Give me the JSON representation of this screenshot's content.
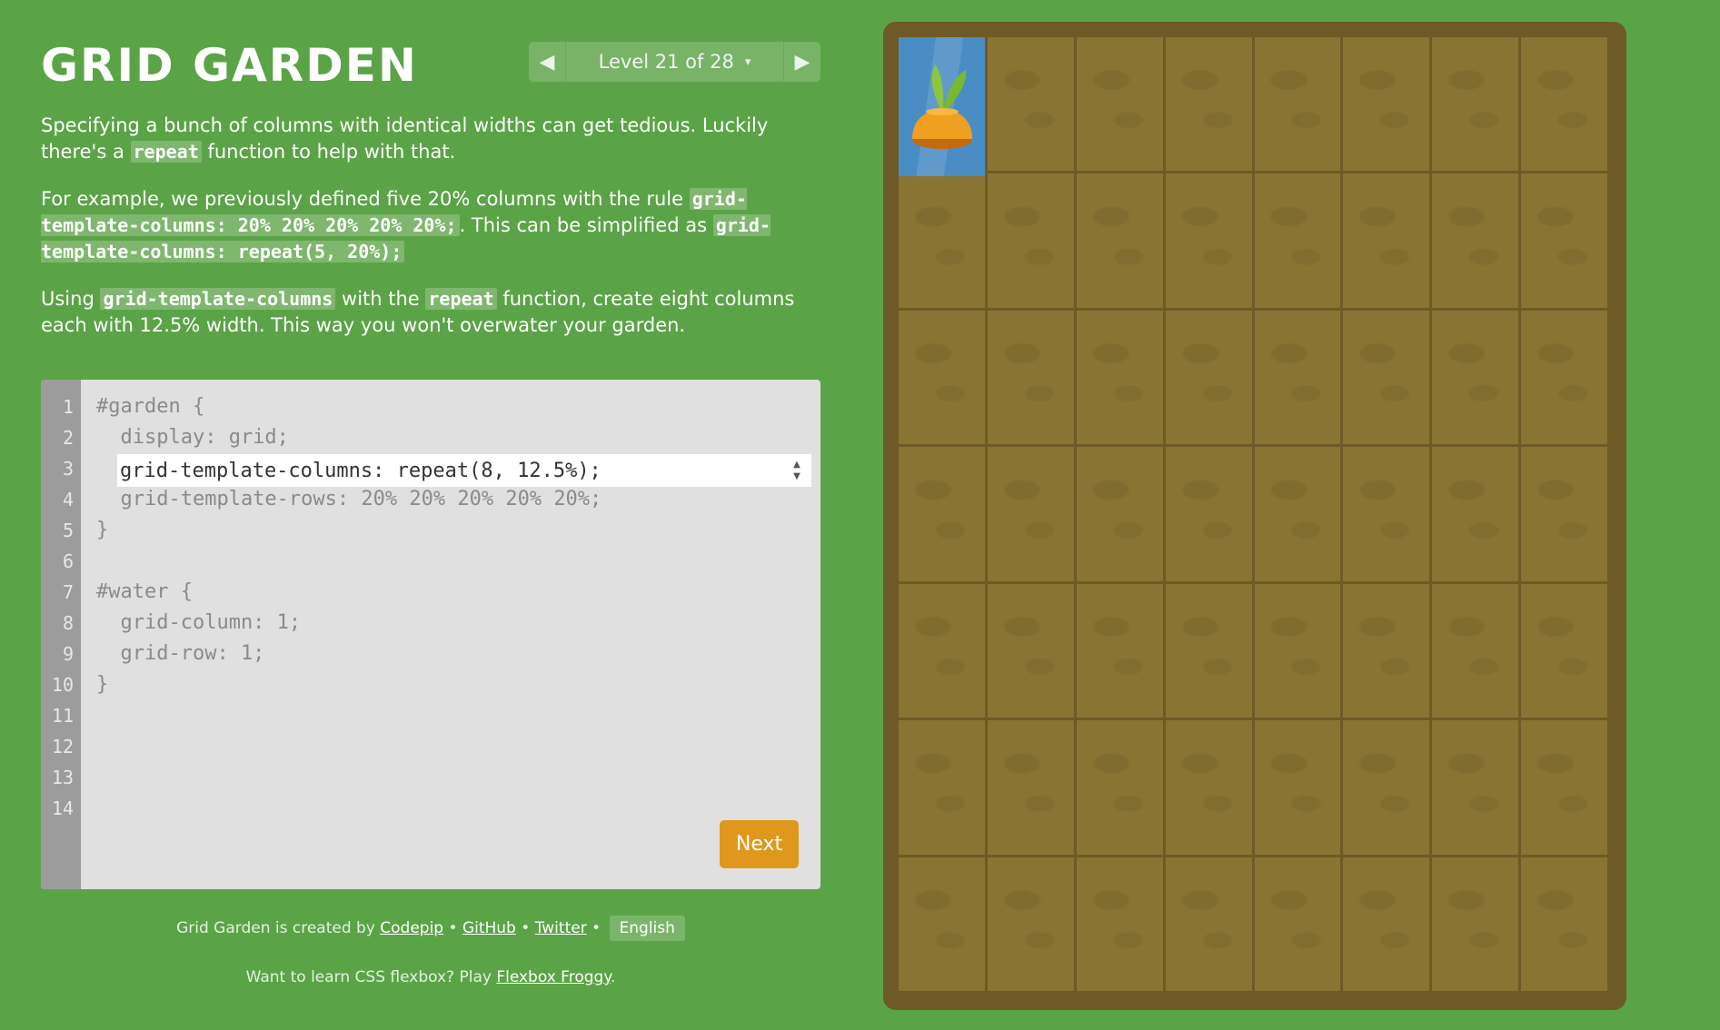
{
  "app": {
    "title": "GRID GARDEN"
  },
  "level_nav": {
    "label": "Level 21 of 28",
    "caret": "▾",
    "prev_icon": "◀",
    "next_icon": "▶"
  },
  "instructions": {
    "p1": {
      "t1": "Specifying a bunch of columns with identical widths can get tedious. Luckily there's a ",
      "c1": "repeat",
      "t2": " function to help with that."
    },
    "p2": {
      "t1": "For example, we previously defined five 20% columns with the rule ",
      "c1": "grid-template-columns: 20% 20% 20% 20% 20%;",
      "t2": ". This can be simplified as ",
      "c2": "grid-template-columns: repeat(5, 20%);"
    },
    "p3": {
      "t1": "Using ",
      "c1": "grid-template-columns",
      "t2": " with the ",
      "c2": "repeat",
      "t3": " function, create eight columns each with 12.5% width. This way you won't overwater your garden."
    }
  },
  "editor": {
    "line_numbers": [
      "1",
      "2",
      "3",
      "4",
      "5",
      "6",
      "7",
      "8",
      "9",
      "10",
      "11",
      "12",
      "13",
      "14"
    ],
    "lines": {
      "l1": "#garden {",
      "l2": "  display: grid;",
      "l4": "  grid-template-rows: 20% 20% 20% 20% 20%;",
      "l5": "}",
      "l7": "#water {",
      "l8": "  grid-column: 1;",
      "l9": "  grid-row: 1;",
      "l10": "}"
    },
    "input_value": "grid-template-columns: repeat(8, 12.5%);",
    "stepper_up": "▲",
    "stepper_down": "▼",
    "next_label": "Next"
  },
  "footer": {
    "created_by": "Grid Garden is created by ",
    "codepip": "Codepip",
    "sep1": " • ",
    "github": "GitHub",
    "sep2": " • ",
    "twitter": "Twitter",
    "sep3": " • ",
    "language": "English",
    "flexbox_text": "Want to learn CSS flexbox? Play ",
    "flexbox_link": "Flexbox Froggy",
    "flexbox_end": "."
  },
  "garden": {
    "columns": 8,
    "rows": 7,
    "water_column": 1,
    "water_row": 1,
    "colors": {
      "background": "#5ba347",
      "soil": "#8a7433",
      "border": "#6e5a26",
      "water": "#4a8dc4",
      "carrot": "#f0a020",
      "button": "#e0981c"
    }
  }
}
